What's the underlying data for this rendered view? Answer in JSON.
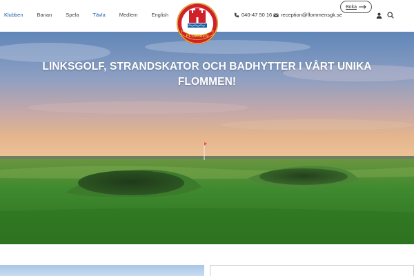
{
  "nav": {
    "items": [
      {
        "label": "Klubben",
        "state": "active"
      },
      {
        "label": "Banan",
        "state": ""
      },
      {
        "label": "Spela",
        "state": ""
      },
      {
        "label": "Tävla",
        "state": "accent"
      },
      {
        "label": "Medlem",
        "state": ""
      },
      {
        "label": "English",
        "state": ""
      }
    ]
  },
  "contact": {
    "phone": "040-47 50 16",
    "email": "reception@flommensgk.se"
  },
  "header": {
    "book_label": "Boka",
    "logo_text": "FLOMMEN"
  },
  "hero": {
    "title": "LINKSGOLF, STRANDSKATOR OCH BADHYTTER I VÅRT UNIKA FLOMMEN!"
  },
  "colors": {
    "accent": "#1a5fa8",
    "logo_red": "#d0202a",
    "logo_gold": "#e2b630"
  }
}
